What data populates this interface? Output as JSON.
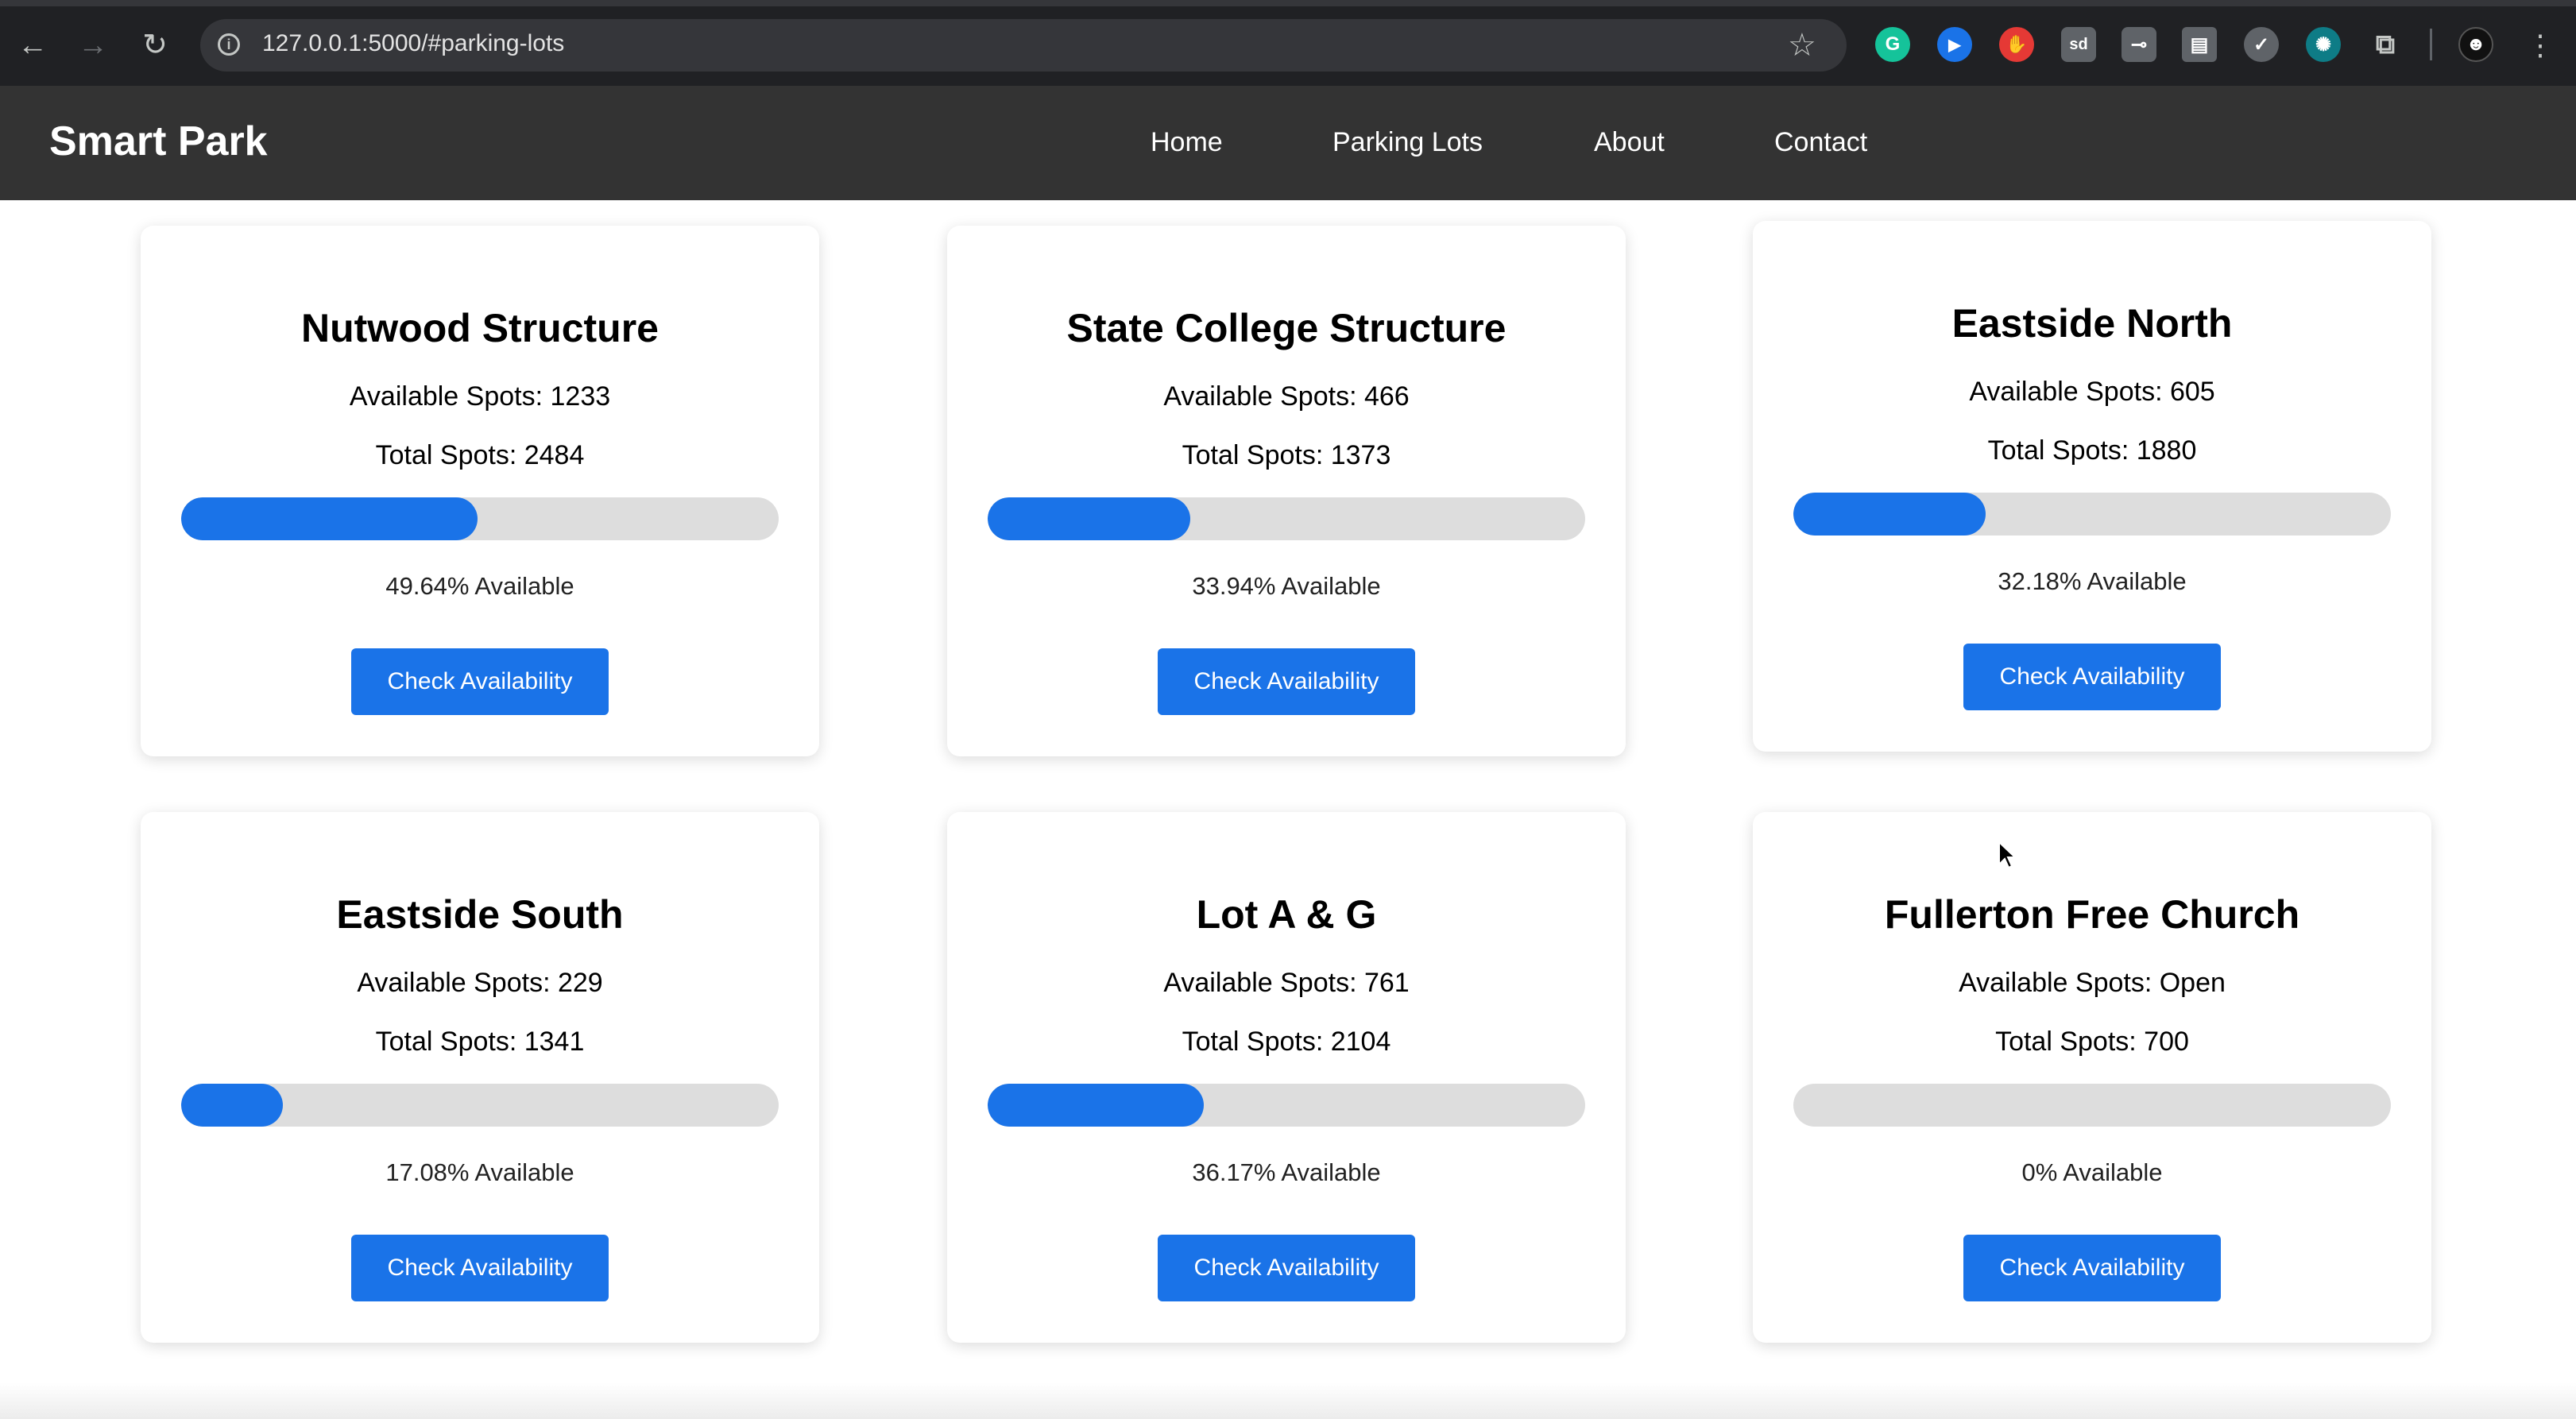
{
  "browser": {
    "url": "127.0.0.1:5000/#parking-lots",
    "extensions": [
      {
        "name": "grammarly-icon",
        "color": "#15c39a",
        "glyph": "G"
      },
      {
        "name": "play-extension-icon",
        "color": "#1a73e8",
        "glyph": "▶"
      },
      {
        "name": "stop-hand-icon",
        "color": "#e53935",
        "glyph": "✋"
      },
      {
        "name": "sd-extension-icon",
        "color": "#5f6368",
        "glyph": "sd"
      },
      {
        "name": "key-extension-icon",
        "color": "#5f6368",
        "glyph": "⊸"
      },
      {
        "name": "document-extension-icon",
        "color": "#5f6368",
        "glyph": "▤"
      },
      {
        "name": "shield-extension-icon",
        "color": "#5f6368",
        "glyph": "✓"
      },
      {
        "name": "globe-extension-icon",
        "color": "#0e7c86",
        "glyph": "✺"
      },
      {
        "name": "puzzle-extensions-icon",
        "color": "#202124",
        "glyph": "⧉"
      }
    ]
  },
  "header": {
    "brand": "Smart Park",
    "nav": [
      "Home",
      "Parking Lots",
      "About",
      "Contact"
    ]
  },
  "colors": {
    "accent": "#1a73e8",
    "header_bg": "#333333",
    "track": "#dddddd"
  },
  "lots": [
    {
      "name": "Nutwood Structure",
      "available": "Available Spots: 1233",
      "total": "Total Spots: 2484",
      "percent_label": "49.64% Available",
      "percent": 49.64,
      "button": "Check Availability"
    },
    {
      "name": "State College Structure",
      "available": "Available Spots: 466",
      "total": "Total Spots: 1373",
      "percent_label": "33.94% Available",
      "percent": 33.94,
      "button": "Check Availability"
    },
    {
      "name": "Eastside North",
      "available": "Available Spots: 605",
      "total": "Total Spots: 1880",
      "percent_label": "32.18% Available",
      "percent": 32.18,
      "button": "Check Availability"
    },
    {
      "name": "Eastside South",
      "available": "Available Spots: 229",
      "total": "Total Spots: 1341",
      "percent_label": "17.08% Available",
      "percent": 17.08,
      "button": "Check Availability"
    },
    {
      "name": "Lot A & G",
      "available": "Available Spots: 761",
      "total": "Total Spots: 2104",
      "percent_label": "36.17% Available",
      "percent": 36.17,
      "button": "Check Availability"
    },
    {
      "name": "Fullerton Free Church",
      "available": "Available Spots: Open",
      "total": "Total Spots: 700",
      "percent_label": "0% Available",
      "percent": 0,
      "button": "Check Availability"
    }
  ]
}
